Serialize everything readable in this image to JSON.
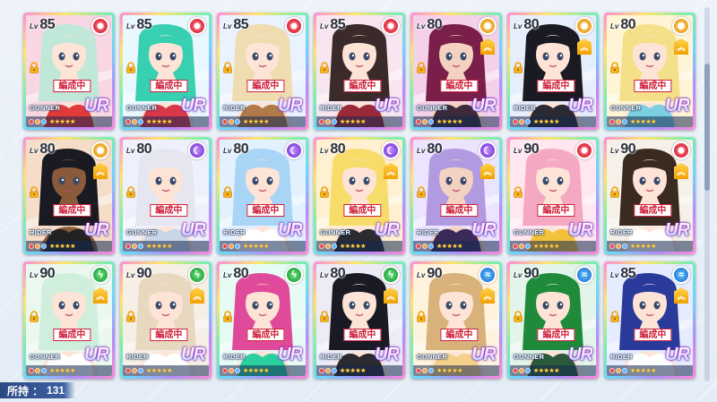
{
  "possess": {
    "label": "所持",
    "separator": "：",
    "count": "131"
  },
  "scroll": {
    "position": 0.23
  },
  "cards": [
    {
      "level": "85",
      "element": "fire",
      "element_glyph": "✹",
      "role": "GUNNER",
      "rarity": "UR",
      "formation": "編成中",
      "rankup": false,
      "hair": "#bfe8d8",
      "skin": "#fde4d6",
      "outfit": "#e23a3a",
      "bg": "#f9d7e2",
      "gems": [
        "#e74a4a",
        "#f2a34a",
        "#5fb3ff"
      ]
    },
    {
      "level": "85",
      "element": "fire",
      "element_glyph": "✹",
      "role": "GUNNER",
      "rarity": "UR",
      "formation": "編成中",
      "rankup": false,
      "hair": "#37d0b0",
      "skin": "#fde4d6",
      "outfit": "#d9384a",
      "bg": "#e9f7ff",
      "gems": [
        "#e74a4a",
        "#f2a34a",
        "#5fb3ff"
      ]
    },
    {
      "level": "85",
      "element": "fire",
      "element_glyph": "✹",
      "role": "RIDER",
      "rarity": "UR",
      "formation": "編成中",
      "rankup": false,
      "hair": "#efdcb0",
      "skin": "#fde4d6",
      "outfit": "#b07a4a",
      "bg": "#eaf2ff",
      "gems": [
        "#e74a4a",
        "#f2a34a",
        "#5fb3ff"
      ]
    },
    {
      "level": "85",
      "element": "fire",
      "element_glyph": "✹",
      "role": "RIDER",
      "rarity": "UR",
      "formation": "編成中",
      "rankup": false,
      "hair": "#3a2a2a",
      "skin": "#fde4d6",
      "outfit": "#9a2a3a",
      "bg": "#f7e6f0",
      "gems": [
        "#e74a4a",
        "#f2a34a",
        "#5fb3ff"
      ]
    },
    {
      "level": "80",
      "element": "sun",
      "element_glyph": "✺",
      "role": "GUNNER",
      "rarity": "UR",
      "formation": "編成中",
      "rankup": true,
      "hair": "#7a1e4a",
      "skin": "#f3d2c2",
      "outfit": "#3a2a3a",
      "bg": "#f5d0ea",
      "gems": [
        "#e74a4a",
        "#f2a34a",
        "#5fb3ff"
      ]
    },
    {
      "level": "80",
      "element": "sun",
      "element_glyph": "✺",
      "role": "RIDER",
      "rarity": "UR",
      "formation": "編成中",
      "rankup": true,
      "hair": "#1a1a22",
      "skin": "#fde4d6",
      "outfit": "#2a2a30",
      "bg": "#e7eefb",
      "gems": [
        "#e74a4a",
        "#f2a34a",
        "#5fb3ff"
      ]
    },
    {
      "level": "80",
      "element": "sun",
      "element_glyph": "✺",
      "role": "GUNNER",
      "rarity": "UR",
      "formation": "編成中",
      "rankup": true,
      "hair": "#f5e08a",
      "skin": "#fde4d6",
      "outfit": "#7ad0e0",
      "bg": "#fff5d6",
      "gems": [
        "#e74a4a",
        "#f2a34a",
        "#5fb3ff"
      ]
    },
    {
      "level": "80",
      "element": "sun",
      "element_glyph": "✺",
      "role": "RIDER",
      "rarity": "UR",
      "formation": "編成中",
      "rankup": true,
      "hair": "#1a1a22",
      "skin": "#8a5a3a",
      "outfit": "#222222",
      "bg": "#f5ddc8",
      "gems": [
        "#e74a4a",
        "#f2a34a",
        "#5fb3ff"
      ]
    },
    {
      "level": "80",
      "element": "moon",
      "element_glyph": "☾",
      "role": "GUNNER",
      "rarity": "UR",
      "formation": "編成中",
      "rankup": false,
      "hair": "#e6e6f0",
      "skin": "#fde4d6",
      "outfit": "#c9d6e8",
      "bg": "#eef0fb",
      "gems": [
        "#e74a4a",
        "#f2a34a",
        "#5fb3ff"
      ]
    },
    {
      "level": "80",
      "element": "moon",
      "element_glyph": "☾",
      "role": "RIDER",
      "rarity": "UR",
      "formation": "編成中",
      "rankup": false,
      "hair": "#a8d4f5",
      "skin": "#fde4d6",
      "outfit": "#ffffff",
      "bg": "#e3f1ff",
      "gems": [
        "#e74a4a",
        "#f2a34a",
        "#5fb3ff"
      ]
    },
    {
      "level": "80",
      "element": "moon",
      "element_glyph": "☾",
      "role": "GUNNER",
      "rarity": "UR",
      "formation": "編成中",
      "rankup": true,
      "hair": "#f7dc6a",
      "skin": "#fde4d6",
      "outfit": "#2a2a30",
      "bg": "#fff0d2",
      "gems": [
        "#e74a4a",
        "#f2a34a",
        "#5fb3ff"
      ]
    },
    {
      "level": "80",
      "element": "moon",
      "element_glyph": "☾",
      "role": "RIDER",
      "rarity": "UR",
      "formation": "編成中",
      "rankup": true,
      "hair": "#b29ae0",
      "skin": "#f3d2c2",
      "outfit": "#3a2a5a",
      "bg": "#ece3ff",
      "gems": [
        "#e74a4a",
        "#f2a34a",
        "#5fb3ff"
      ]
    },
    {
      "level": "90",
      "element": "fire",
      "element_glyph": "✹",
      "role": "GUNNER",
      "rarity": "UR",
      "formation": "編成中",
      "rankup": false,
      "hair": "#f5a8c2",
      "skin": "#fde4d6",
      "outfit": "#f2c23a",
      "bg": "#ffe6f0",
      "gems": [
        "#e74a4a",
        "#f2a34a",
        "#5fb3ff"
      ]
    },
    {
      "level": "90",
      "element": "fire",
      "element_glyph": "✹",
      "role": "RIDER",
      "rarity": "UR",
      "formation": "編成中",
      "rankup": true,
      "hair": "#3a2a20",
      "skin": "#fde4d6",
      "outfit": "#ffffff",
      "bg": "#f5f0e8",
      "gems": [
        "#e74a4a",
        "#f2a34a",
        "#5fb3ff"
      ]
    },
    {
      "level": "90",
      "element": "wind",
      "element_glyph": "ϟ",
      "role": "GUNNER",
      "rarity": "UR",
      "formation": "編成中",
      "rankup": true,
      "hair": "#cfeedc",
      "skin": "#fde4d6",
      "outfit": "#ffffff",
      "bg": "#eaf8f0",
      "gems": [
        "#e74a4a",
        "#f2a34a",
        "#5fb3ff"
      ]
    },
    {
      "level": "90",
      "element": "wind",
      "element_glyph": "ϟ",
      "role": "RIDER",
      "rarity": "UR",
      "formation": "編成中",
      "rankup": true,
      "hair": "#e8d8c0",
      "skin": "#fde4d6",
      "outfit": "#ffffff",
      "bg": "#f5efe6",
      "gems": [
        "#e74a4a",
        "#f2a34a",
        "#5fb3ff"
      ]
    },
    {
      "level": "80",
      "element": "wind",
      "element_glyph": "ϟ",
      "role": "RIDER",
      "rarity": "UR",
      "formation": "編成中",
      "rankup": false,
      "hair": "#e04a9a",
      "skin": "#fde4d6",
      "outfit": "#2ad0a0",
      "bg": "#e6fbf4",
      "gems": [
        "#e74a4a",
        "#f2a34a",
        "#5fb3ff"
      ]
    },
    {
      "level": "80",
      "element": "wind",
      "element_glyph": "ϟ",
      "role": "RIDER",
      "rarity": "UR",
      "formation": "編成中",
      "rankup": true,
      "hair": "#1a1a24",
      "skin": "#fde4d6",
      "outfit": "#2a2a30",
      "bg": "#ecebf6",
      "gems": [
        "#e74a4a",
        "#f2a34a",
        "#5fb3ff"
      ]
    },
    {
      "level": "90",
      "element": "water",
      "element_glyph": "≈",
      "role": "GUNNER",
      "rarity": "UR",
      "formation": "編成中",
      "rankup": true,
      "hair": "#d8b27a",
      "skin": "#fde4d6",
      "outfit": "#f5d08a",
      "bg": "#fff3de",
      "gems": [
        "#e74a4a",
        "#f2a34a",
        "#5fb3ff"
      ]
    },
    {
      "level": "90",
      "element": "water",
      "element_glyph": "≈",
      "role": "GUNNER",
      "rarity": "UR",
      "formation": "編成中",
      "rankup": false,
      "hair": "#1f8a3a",
      "skin": "#fde4d6",
      "outfit": "#2a5a3a",
      "bg": "#e3f5ea",
      "gems": [
        "#e74a4a",
        "#f2a34a",
        "#5fb3ff"
      ]
    },
    {
      "level": "85",
      "element": "water",
      "element_glyph": "≈",
      "role": "RIDER",
      "rarity": "UR",
      "formation": "編成中",
      "rankup": true,
      "hair": "#2a3a9a",
      "skin": "#fde4d6",
      "outfit": "#ffffff",
      "bg": "#e6ecff",
      "gems": [
        "#e74a4a",
        "#f2a34a",
        "#5fb3ff"
      ]
    }
  ]
}
